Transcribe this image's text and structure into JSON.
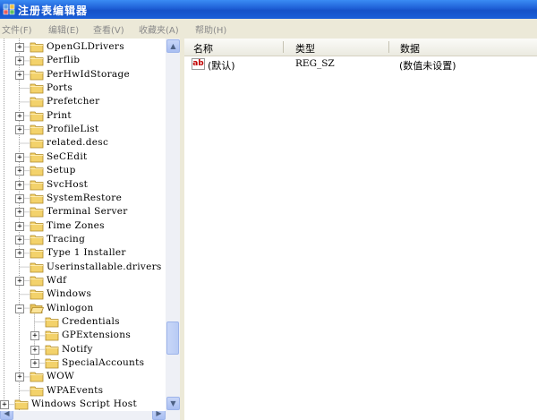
{
  "window": {
    "title": "注册表编辑器"
  },
  "menu": [
    {
      "label": "文件(F)"
    },
    {
      "label": "编辑(E)"
    },
    {
      "label": "查看(V)"
    },
    {
      "label": "收藏夹(A)"
    },
    {
      "label": "帮助(H)"
    }
  ],
  "tree": {
    "items": [
      {
        "label": "OpenGLDrivers",
        "level": 1,
        "expandable": true
      },
      {
        "label": "Perflib",
        "level": 1,
        "expandable": true
      },
      {
        "label": "PerHwIdStorage",
        "level": 1,
        "expandable": true
      },
      {
        "label": "Ports",
        "level": 1,
        "expandable": false
      },
      {
        "label": "Prefetcher",
        "level": 1,
        "expandable": false
      },
      {
        "label": "Print",
        "level": 1,
        "expandable": true
      },
      {
        "label": "ProfileList",
        "level": 1,
        "expandable": true
      },
      {
        "label": "related.desc",
        "level": 1,
        "expandable": false
      },
      {
        "label": "SeCEdit",
        "level": 1,
        "expandable": true
      },
      {
        "label": "Setup",
        "level": 1,
        "expandable": true
      },
      {
        "label": "SvcHost",
        "level": 1,
        "expandable": true
      },
      {
        "label": "SystemRestore",
        "level": 1,
        "expandable": true
      },
      {
        "label": "Terminal Server",
        "level": 1,
        "expandable": true
      },
      {
        "label": "Time Zones",
        "level": 1,
        "expandable": true
      },
      {
        "label": "Tracing",
        "level": 1,
        "expandable": true
      },
      {
        "label": "Type 1 Installer",
        "level": 1,
        "expandable": true
      },
      {
        "label": "Userinstallable.drivers",
        "level": 1,
        "expandable": false
      },
      {
        "label": "Wdf",
        "level": 1,
        "expandable": true
      },
      {
        "label": "Windows",
        "level": 1,
        "expandable": false
      },
      {
        "label": "Winlogon",
        "level": 1,
        "expandable": true,
        "expanded": true
      },
      {
        "label": "Credentials",
        "level": 2,
        "expandable": false
      },
      {
        "label": "GPExtensions",
        "level": 2,
        "expandable": true
      },
      {
        "label": "Notify",
        "level": 2,
        "expandable": true
      },
      {
        "label": "SpecialAccounts",
        "level": 2,
        "expandable": true
      },
      {
        "label": "WOW",
        "level": 1,
        "expandable": true
      },
      {
        "label": "WPAEvents",
        "level": 1,
        "expandable": false
      },
      {
        "label": "Windows Script Host",
        "level": 0,
        "expandable": true
      }
    ]
  },
  "list": {
    "columns": [
      "名称",
      "类型",
      "数据"
    ],
    "rows": [
      {
        "name": "(默认)",
        "type": "REG_SZ",
        "data": "(数值未设置)",
        "icon": "string-value-icon"
      }
    ]
  },
  "colors": {
    "titlebar": "#1e5fd6",
    "window_bg": "#ece9d8",
    "folder": "#f3d26b",
    "string_icon_text": "#c00000"
  }
}
